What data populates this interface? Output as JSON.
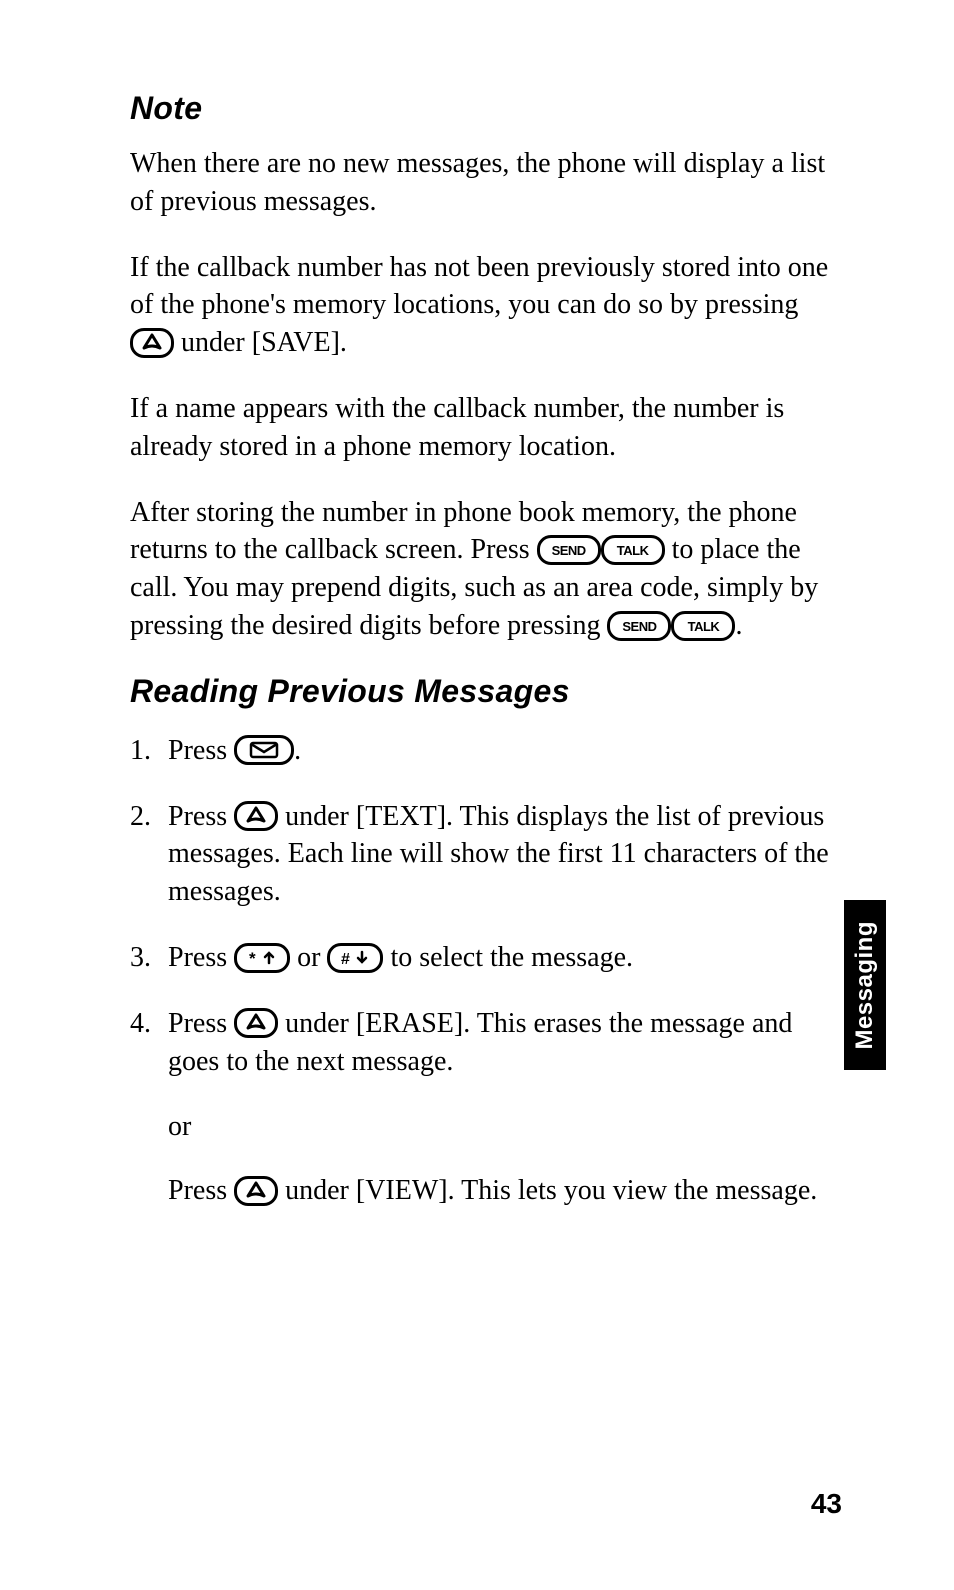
{
  "headings": {
    "note": "Note",
    "section": "Reading Previous Messages"
  },
  "paragraphs": {
    "p1": "When there are no new messages, the phone will display a list of previous messages.",
    "p2a": "If the callback number has not been previously stored into one of the phone's memory locations, you can do so by pressing ",
    "p2b": " under [SAVE].",
    "p3": "If a name appears with the callback number, the number is already stored in a phone memory location.",
    "p4a": "After storing the number in phone book memory, the phone returns to the callback screen. Press ",
    "p4b": " to place the call. You may prepend digits, such as an area code, simply by pressing the desired digits before pressing ",
    "p4c": "."
  },
  "steps": {
    "s1a": "Press ",
    "s1b": ".",
    "s2a": "Press ",
    "s2b": " under [TEXT]. This displays the list of previous messages. Each line will show the first 11 characters of the messages.",
    "s3a": "Press ",
    "s3b": " or ",
    "s3c": " to select the message.",
    "s4a": "Press ",
    "s4b": " under  [ERASE]. This erases the message and goes to the next message.",
    "or": "or",
    "s4c": "Press ",
    "s4d": " under  [VIEW]. This lets you view the message."
  },
  "buttons": {
    "send": "SEND",
    "talk": "TALK"
  },
  "sideTab": "Messaging",
  "pageNumber": "43"
}
